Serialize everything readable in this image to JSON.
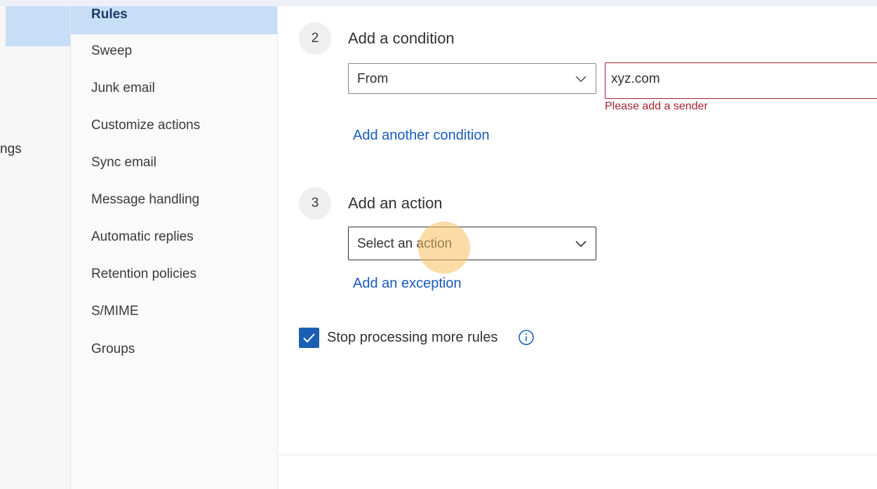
{
  "left_nav": {
    "partial_label": "ngs"
  },
  "sub_nav": {
    "items": [
      {
        "label": "Rules",
        "active": true
      },
      {
        "label": "Sweep"
      },
      {
        "label": "Junk email"
      },
      {
        "label": "Customize actions"
      },
      {
        "label": "Sync email"
      },
      {
        "label": "Message handling"
      },
      {
        "label": "Automatic replies"
      },
      {
        "label": "Retention policies"
      },
      {
        "label": "S/MIME"
      },
      {
        "label": "Groups"
      }
    ]
  },
  "condition": {
    "step_number": "2",
    "title": "Add a condition",
    "dropdown_value": "From",
    "input_value": "xyz.com",
    "error_text": "Please add a sender",
    "add_another_link": "Add another condition"
  },
  "action": {
    "step_number": "3",
    "title": "Add an action",
    "dropdown_placeholder": "Select an action",
    "add_exception_link": "Add an exception"
  },
  "stop_processing": {
    "label": "Stop processing more rules",
    "checked": true
  },
  "icons": {
    "dropdown": "chevron-down-icon",
    "checkbox": "checkmark-icon",
    "info": "info-icon"
  },
  "colors": {
    "accent": "#1a5fb4",
    "link": "#185abd",
    "error": "#a4262c",
    "selection": "#c8def7"
  }
}
